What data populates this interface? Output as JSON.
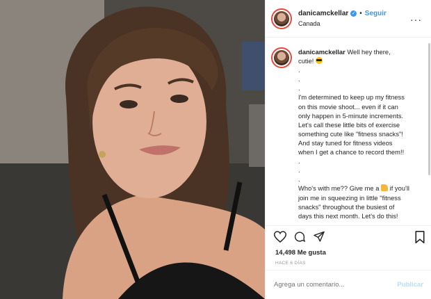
{
  "post": {
    "username": "danicamckellar",
    "follow_label": "Seguir",
    "dot": "•",
    "location": "Canada",
    "more_icon": "ellipsis-icon",
    "close_icon": "×"
  },
  "caption": {
    "username": "danicamckellar",
    "lines": [
      "Well hey there,",
      "cutie!",
      ".",
      ".",
      ".",
      "I'm determined to keep up my fitness",
      "on this movie shoot... even if it can",
      "only happen in 5-minute increments.",
      "Let's call these little bits of exercise",
      "something cute like \"fitness snacks\"!",
      "And stay tuned for fitness videos",
      "when I get a chance to record them!!",
      ".",
      ".",
      ".",
      "Who's with me?? Give me a",
      "if you'll",
      "join me in squeezing in little \"fitness",
      "snacks\" throughout the busiest of",
      "days this next month. Let's do this!"
    ]
  },
  "stats": {
    "likes": "14,498 Me gusta",
    "time_ago": "HACE 6 DÍAS"
  },
  "comment": {
    "placeholder": "Agrega un comentario...",
    "publish_label": "Publicar"
  },
  "colors": {
    "accent": "#3897f0",
    "ring": "#e8473c",
    "publish_disabled": "#b2dffc"
  }
}
